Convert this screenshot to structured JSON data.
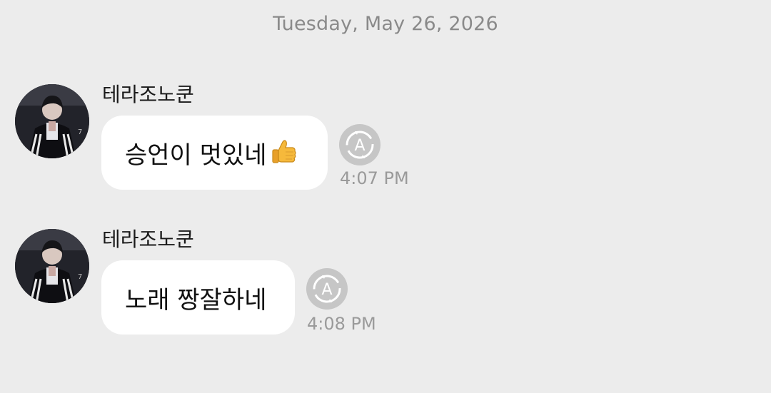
{
  "date_divider": "Tuesday, May 26, 2026",
  "messages": [
    {
      "sender": "테라조노쿤",
      "text": "승언이 멋있네",
      "emoji": "thumbs-up",
      "time": "4:07 PM",
      "translate_icon_letter": "A"
    },
    {
      "sender": "테라조노쿤",
      "text": "노래 짱잘하네",
      "time": "4:08 PM",
      "translate_icon_letter": "A"
    }
  ],
  "colors": {
    "background": "#ececec",
    "bubble": "#ffffff",
    "translate_button": "#c6c6c6",
    "timestamp": "#9a9a9a",
    "date_text": "#8a8a8a"
  }
}
